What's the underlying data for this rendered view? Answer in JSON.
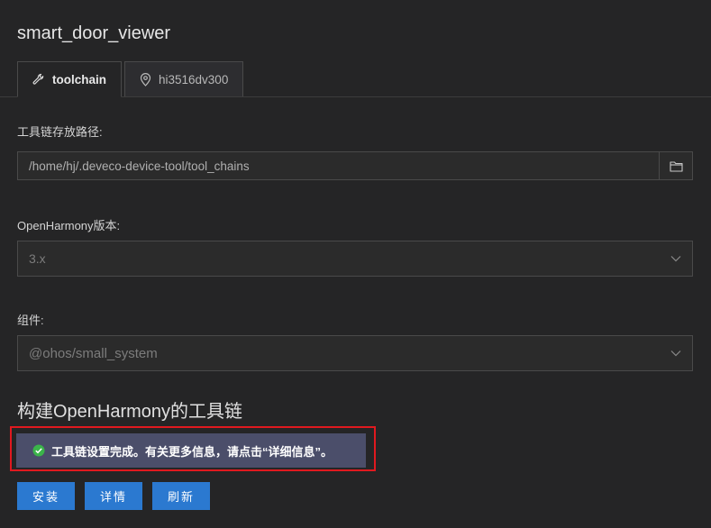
{
  "project_title": "smart_door_viewer",
  "tabs": [
    {
      "label": "toolchain",
      "icon": "wrench-icon",
      "active": true
    },
    {
      "label": "hi3516dv300",
      "icon": "location-pin-icon",
      "active": false
    }
  ],
  "toolchain_path": {
    "label": "工具链存放路径:",
    "value": "/home/hj/.deveco-device-tool/tool_chains",
    "browse_icon": "folder-icon"
  },
  "openharmony_version": {
    "label": "OpenHarmony版本:",
    "value": "3.x"
  },
  "component": {
    "label": "组件:",
    "value": "@ohos/small_system"
  },
  "build_section": {
    "heading": "构建OpenHarmony的工具链",
    "notice": "工具链设置完成。有关更多信息，请点击“详细信息”。",
    "notice_icon": "check-circle-icon"
  },
  "actions": {
    "install": "安装",
    "details": "详情",
    "refresh": "刷新"
  },
  "colors": {
    "background": "#252526",
    "accent_button": "#2b79d0",
    "notice_bg": "#4b4e6a",
    "highlight_border": "#e0191f",
    "success_green": "#3bb54a"
  }
}
